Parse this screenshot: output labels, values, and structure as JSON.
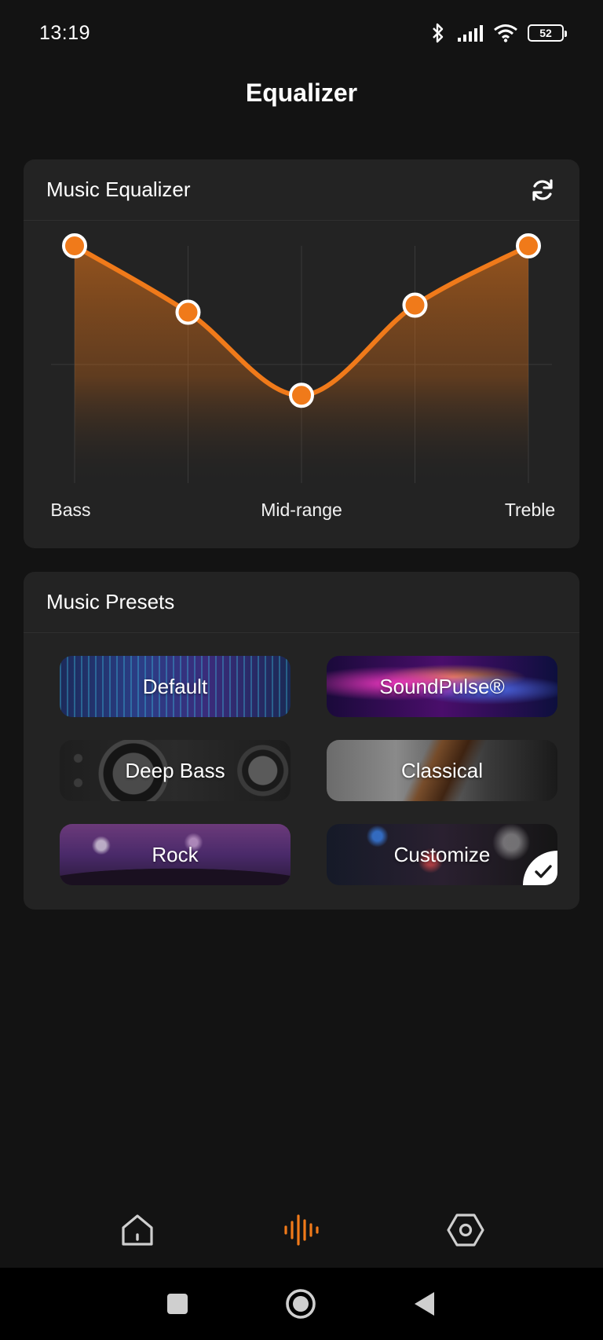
{
  "status_bar": {
    "time": "13:19",
    "battery_level": "52",
    "icons": [
      "bluetooth-icon",
      "signal-icon",
      "wifi-icon",
      "battery-icon"
    ]
  },
  "page": {
    "title": "Equalizer"
  },
  "equalizer": {
    "title": "Music Equalizer",
    "reset_icon": "refresh-icon",
    "accent_color": "#f07a1a",
    "band_levels": [
      1.0,
      0.72,
      0.37,
      0.75,
      1.0
    ],
    "labels": {
      "bass": "Bass",
      "mid": "Mid-range",
      "treble": "Treble"
    }
  },
  "presets": {
    "title": "Music Presets",
    "items": [
      {
        "label": "Default",
        "selected": false
      },
      {
        "label": "SoundPulse®",
        "selected": false
      },
      {
        "label": "Deep Bass",
        "selected": false
      },
      {
        "label": "Classical",
        "selected": false
      },
      {
        "label": "Rock",
        "selected": false
      },
      {
        "label": "Customize",
        "selected": true
      }
    ]
  },
  "bottom_nav": {
    "items": [
      {
        "icon": "home-icon",
        "active": false
      },
      {
        "icon": "equalizer-icon",
        "active": true
      },
      {
        "icon": "settings-icon",
        "active": false
      }
    ],
    "active_color": "#f07a1a",
    "inactive_color": "#cfcfcf"
  },
  "system_nav": [
    "recents-button",
    "home-button",
    "back-button"
  ]
}
